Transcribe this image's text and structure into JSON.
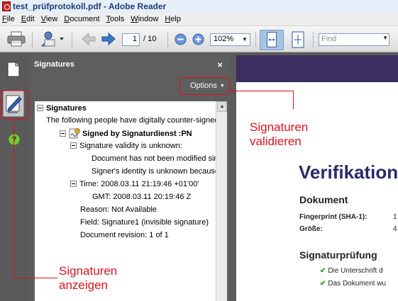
{
  "window": {
    "title": "test_prüfprotokoll.pdf - Adobe Reader"
  },
  "menu": [
    {
      "label": "File",
      "u": "F",
      "rest": "ile"
    },
    {
      "label": "Edit",
      "u": "E",
      "rest": "dit"
    },
    {
      "label": "View",
      "u": "V",
      "rest": "iew"
    },
    {
      "label": "Document",
      "u": "D",
      "rest": "ocument"
    },
    {
      "label": "Tools",
      "u": "T",
      "rest": "ools"
    },
    {
      "label": "Window",
      "u": "W",
      "rest": "indow"
    },
    {
      "label": "Help",
      "u": "H",
      "rest": "elp"
    }
  ],
  "toolbar": {
    "page_current": "1",
    "page_total": "/ 10",
    "zoom": "102%",
    "find_placeholder": "Find"
  },
  "nav_icons": [
    "pages-icon",
    "signature-pen-icon",
    "help-icon"
  ],
  "signatures_panel": {
    "title": "Signatures",
    "close": "×",
    "options_label": "Options",
    "tree": {
      "root": "Signatures",
      "intro": "The following people have digitally counter-signed",
      "signer": "Signed by Signaturdienst :PN",
      "validity": "Signature validity is unknown:",
      "not_modified": "Document has not been modified since",
      "identity": "Signer's identity is unknown because",
      "time": "Time: 2008.03.11 21:19:46 +01'00'",
      "gmt": "GMT: 2008.03.11 20:19:46 Z",
      "reason": "Reason: Not Available",
      "field": "Field: Signature1 (invisible signature)",
      "revision": "Document revision: 1 of 1"
    }
  },
  "document": {
    "heading": "Verifikation",
    "section1": "Dokument",
    "fp_label": "Fingerprint (SHA-1):",
    "fp_value": "1",
    "size_label": "Größe:",
    "size_value": "4",
    "section2": "Signaturprüfung",
    "check1": "Die Unterschrift d",
    "check2": "Das Dokument wu"
  },
  "annotations": {
    "validate": [
      "Signaturen",
      "validieren"
    ],
    "show": [
      "Signaturen",
      "anzeigen"
    ],
    "color": "#d8141c"
  }
}
